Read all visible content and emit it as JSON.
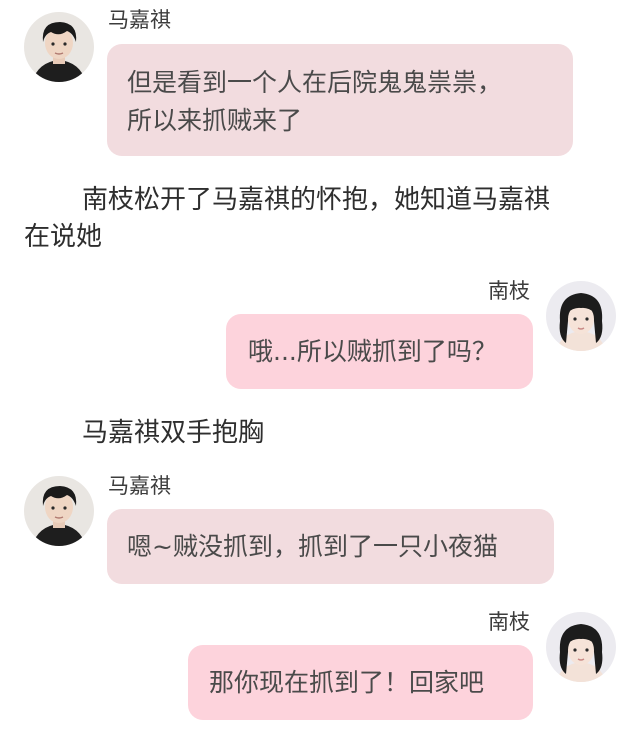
{
  "colors": {
    "left_bubble": "#f2dcdf",
    "right_bubble": "#fdd3dc",
    "background": "#ffffff"
  },
  "messages": [
    {
      "type": "chat",
      "side": "left",
      "speaker": "马嘉祺",
      "avatar": "male-avatar",
      "lines": [
        "但是看到一个人在后院鬼鬼祟祟，",
        "所以来抓贼来了"
      ]
    },
    {
      "type": "narration",
      "lines": [
        "南枝松开了马嘉祺的怀抱，她知道马嘉祺",
        "在说她"
      ]
    },
    {
      "type": "chat",
      "side": "right",
      "speaker": "南枝",
      "avatar": "female-avatar",
      "lines": [
        "哦...所以贼抓到了吗？"
      ]
    },
    {
      "type": "narration",
      "lines": [
        "马嘉祺双手抱胸"
      ]
    },
    {
      "type": "chat",
      "side": "left",
      "speaker": "马嘉祺",
      "avatar": "male-avatar",
      "lines": [
        "嗯~贼没抓到，抓到了一只小夜猫"
      ]
    },
    {
      "type": "chat",
      "side": "right",
      "speaker": "南枝",
      "avatar": "female-avatar",
      "lines": [
        "那你现在抓到了！回家吧"
      ]
    }
  ]
}
